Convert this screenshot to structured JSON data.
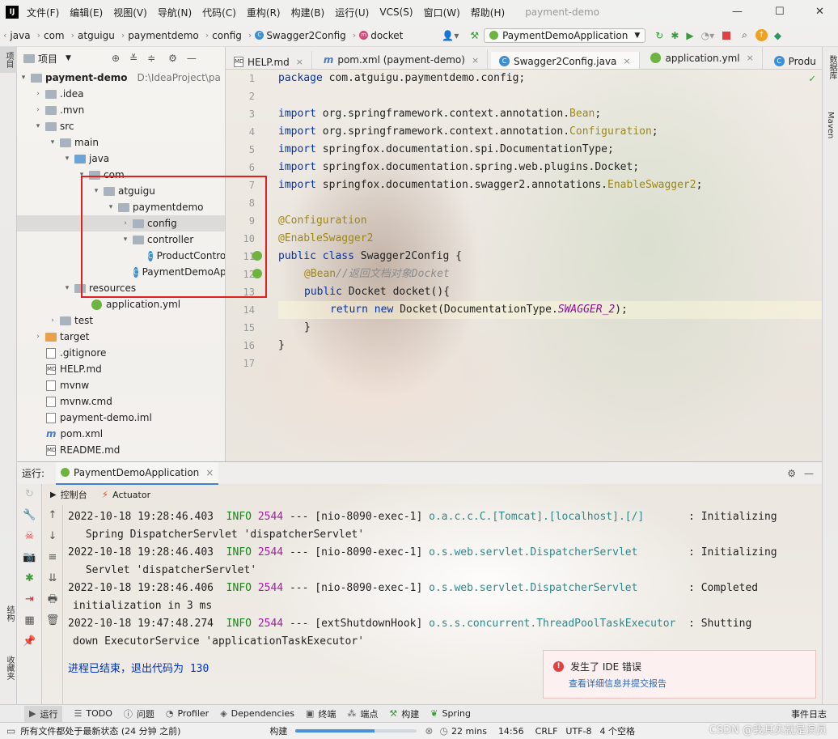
{
  "menubar": {
    "logo": "IJ",
    "items": [
      "文件(F)",
      "编辑(E)",
      "视图(V)",
      "导航(N)",
      "代码(C)",
      "重构(R)",
      "构建(B)",
      "运行(U)",
      "VCS(S)",
      "窗口(W)",
      "帮助(H)"
    ],
    "project_title": "payment-demo",
    "minimize": "—",
    "maximize": "☐",
    "close": "✕"
  },
  "navbar": {
    "crumbs": [
      "java",
      "com",
      "atguigu",
      "paymentdemo",
      "config",
      "Swagger2Config",
      "docket"
    ],
    "run_config": "PaymentDemoApplication"
  },
  "left_strip": {
    "project_label": "项目",
    "structure_label": "结构",
    "favorites_label": "收藏夹"
  },
  "right_strip": {
    "database_label": "数据库",
    "maven_label": "Maven"
  },
  "project_panel": {
    "title": "项目",
    "items": [
      {
        "label": "payment-demo",
        "path": "D:\\IdeaProject\\pa"
      },
      {
        "label": ".idea"
      },
      {
        "label": ".mvn"
      },
      {
        "label": "src"
      },
      {
        "label": "main"
      },
      {
        "label": "java"
      },
      {
        "label": "com"
      },
      {
        "label": "atguigu"
      },
      {
        "label": "paymentdemo"
      },
      {
        "label": "config"
      },
      {
        "label": "controller"
      },
      {
        "label": "ProductController"
      },
      {
        "label": "PaymentDemoApplication"
      },
      {
        "label": "resources"
      },
      {
        "label": "application.yml"
      },
      {
        "label": "test"
      },
      {
        "label": "target"
      },
      {
        "label": ".gitignore"
      },
      {
        "label": "HELP.md"
      },
      {
        "label": "mvnw"
      },
      {
        "label": "mvnw.cmd"
      },
      {
        "label": "payment-demo.iml"
      },
      {
        "label": "pom.xml"
      },
      {
        "label": "README.md"
      }
    ]
  },
  "tabs": [
    {
      "label": "HELP.md",
      "icon": "MD"
    },
    {
      "label": "pom.xml (payment-demo)",
      "icon": "m"
    },
    {
      "label": "Swagger2Config.java",
      "icon": "C"
    },
    {
      "label": "application.yml",
      "icon": "yml"
    },
    {
      "label": "Produ",
      "icon": "C"
    }
  ],
  "editor": {
    "line_numbers": [
      "1",
      "2",
      "3",
      "4",
      "5",
      "6",
      "7",
      "8",
      "9",
      "10",
      "11",
      "12",
      "13",
      "14",
      "15",
      "16",
      "17"
    ],
    "package_kw": "package",
    "package_name": " com.atguigu.paymentdemo.config;",
    "imports": [
      {
        "kw": "import",
        "path": " org.springframework.context.annotation.",
        "name": "Bean",
        "end": ";"
      },
      {
        "kw": "import",
        "path": " org.springframework.context.annotation.",
        "name": "Configuration",
        "end": ";"
      },
      {
        "kw": "import",
        "path": " springfox.documentation.spi.DocumentationType;",
        "name": "",
        "end": ""
      },
      {
        "kw": "import",
        "path": " springfox.documentation.spring.web.plugins.Docket;",
        "name": "",
        "end": ""
      },
      {
        "kw": "import",
        "path": " springfox.documentation.swagger2.annotations.",
        "name": "EnableSwagger2",
        "end": ";"
      }
    ],
    "ann_config": "@Configuration",
    "ann_swagger": "@EnableSwagger2",
    "class_kw": "public class",
    "class_name": " Swagger2Config {",
    "bean_ann": "@Bean",
    "bean_comment": "//返回文档对象Docket",
    "method_kw": "public",
    "method_sig": " Docket docket(){",
    "return_kw": "return new",
    "return_expr": " Docket(DocumentationType.",
    "return_const": "SWAGGER_2",
    "return_end": ");",
    "close_method": "}",
    "close_class": "}"
  },
  "run_panel": {
    "label": "运行:",
    "config": "PaymentDemoApplication",
    "tab_console": "控制台",
    "tab_actuator": "Actuator",
    "logs": [
      {
        "ts": "2022-10-18 19:28:46.403",
        "level": "INFO",
        "pid": "2544",
        "thread": " --- [nio-8090-exec-1] ",
        "logger": "o.a.c.c.C.[Tomcat].[localhost].[/]      ",
        "msg": " : Initializing",
        "cont": " Spring DispatcherServlet 'dispatcherServlet'"
      },
      {
        "ts": "2022-10-18 19:28:46.403",
        "level": "INFO",
        "pid": "2544",
        "thread": " --- [nio-8090-exec-1] ",
        "logger": "o.s.web.servlet.DispatcherServlet       ",
        "msg": " : Initializing",
        "cont": " Servlet 'dispatcherServlet'"
      },
      {
        "ts": "2022-10-18 19:28:46.406",
        "level": "INFO",
        "pid": "2544",
        "thread": " --- [nio-8090-exec-1] ",
        "logger": "o.s.web.servlet.DispatcherServlet       ",
        "msg": " : Completed",
        "cont": "initialization in 3 ms"
      },
      {
        "ts": "2022-10-18 19:47:48.274",
        "level": "INFO",
        "pid": "2544",
        "thread": " --- [extShutdownHook] ",
        "logger": "o.s.s.concurrent.ThreadPoolTaskExecutor ",
        "msg": " : Shutting",
        "cont": "down ExecutorService 'applicationTaskExecutor'"
      }
    ],
    "exit_message": "进程已结束，退出代码为 130"
  },
  "notification": {
    "title": "发生了 IDE 错误",
    "link": "查看详细信息并提交报告"
  },
  "bottom_tools": [
    "运行",
    "TODO",
    "问题",
    "Profiler",
    "Dependencies",
    "终端",
    "端点",
    "构建",
    "Spring"
  ],
  "event_log": "事件日志",
  "status": {
    "message": "所有文件都处于最新状态 (24 分钟 之前)",
    "build_label": "构建",
    "build_progress": 0.65,
    "time_ago": "22 mins",
    "position": "14:56",
    "line_sep": "CRLF",
    "encoding": "UTF-8",
    "indent": "4 个空格",
    "watermark": "CSDN @我其实就是演员"
  }
}
